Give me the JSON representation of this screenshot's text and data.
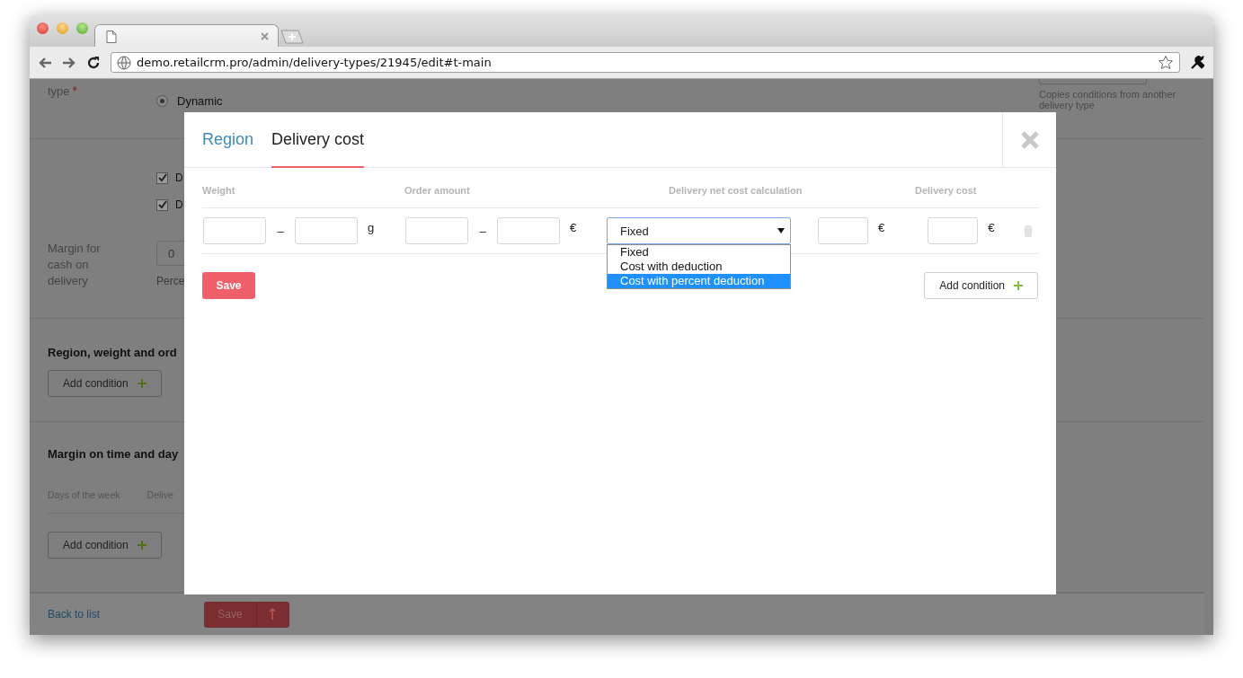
{
  "browser": {
    "url": "demo.retailcrm.pro/admin/delivery-types/21945/edit#t-main"
  },
  "page": {
    "type_label": "type",
    "required_mark": "*",
    "radio": {
      "label": "Dynamic",
      "selected": true
    },
    "copy_hint": "Copies conditions from another delivery type",
    "checkboxes": [
      {
        "label": "D",
        "checked": true
      },
      {
        "label": "D",
        "checked": true
      }
    ],
    "margin": {
      "label": "Margin for cash on delivery",
      "value": "0",
      "hint": "Perce"
    },
    "sections": [
      {
        "title": "Region, weight and ord",
        "button": "Add condition"
      },
      {
        "title": "Margin on time and day",
        "columns": [
          "Days of the week",
          "Delive"
        ],
        "button": "Add condition"
      }
    ],
    "footer": {
      "back_link": "Back to list",
      "save_button": "Save"
    }
  },
  "modal": {
    "tabs": [
      {
        "label": "Region",
        "selected": false
      },
      {
        "label": "Delivery cost",
        "selected": true
      }
    ],
    "columns": [
      "Weight",
      "Order amount",
      "Delivery net cost calculation",
      "Delivery cost"
    ],
    "row": {
      "weight_separator": "–",
      "weight_unit": "g",
      "amount_separator": "–",
      "amount_currency": "€",
      "calculation": {
        "value": "Fixed",
        "open": true,
        "options": [
          {
            "label": "Fixed",
            "highlighted": false
          },
          {
            "label": "Cost with deduction",
            "highlighted": false
          },
          {
            "label": "Cost with percent deduction",
            "highlighted": true
          }
        ]
      },
      "net_cost_currency": "€",
      "cost_currency": "€"
    },
    "save_button": "Save",
    "add_button": "Add condition"
  }
}
